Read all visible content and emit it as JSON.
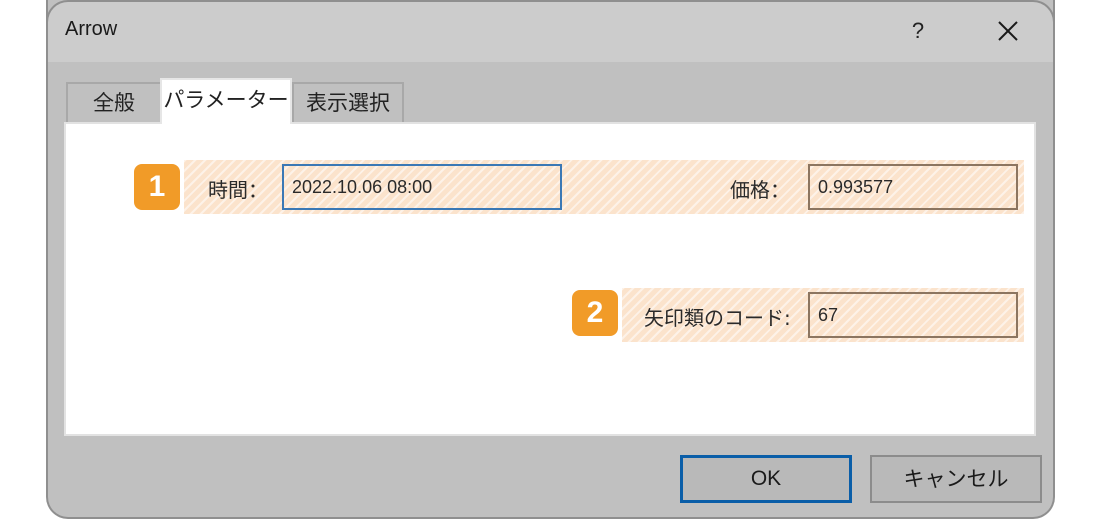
{
  "window": {
    "title": "Arrow",
    "help_label": "?",
    "close_icon": "close-icon"
  },
  "tabs": [
    {
      "label": "全般",
      "active": false
    },
    {
      "label": "パラメーター",
      "active": true
    },
    {
      "label": "表示選択",
      "active": false
    }
  ],
  "parameters": {
    "time": {
      "badge": "1",
      "label": "時間：",
      "value": "2022.10.06 08:00"
    },
    "price": {
      "label": "価格：",
      "value": "0.993577"
    },
    "arrow_code": {
      "badge": "2",
      "label": "矢印類のコード:",
      "value": "67"
    }
  },
  "buttons": {
    "ok": "OK",
    "cancel": "キャンセル"
  },
  "colors": {
    "badge": "#f19b28",
    "highlight": "#fbe3cc",
    "focus_border": "#3b78b5",
    "default_button_border": "#0a5ea8"
  }
}
